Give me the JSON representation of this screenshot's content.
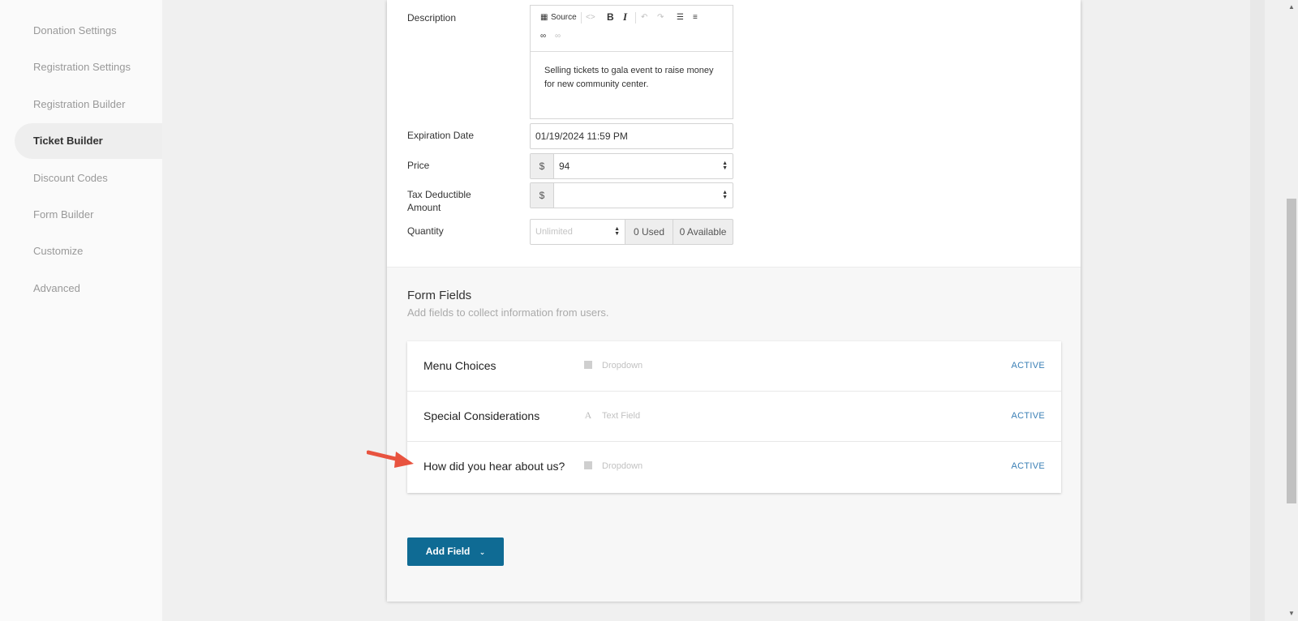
{
  "sidebar": {
    "items": [
      {
        "label": "Donation Settings",
        "active": false
      },
      {
        "label": "Registration Settings",
        "active": false
      },
      {
        "label": "Registration Builder",
        "active": false
      },
      {
        "label": "Ticket Builder",
        "active": true
      },
      {
        "label": "Discount Codes",
        "active": false
      },
      {
        "label": "Form Builder",
        "active": false
      },
      {
        "label": "Customize",
        "active": false
      },
      {
        "label": "Advanced",
        "active": false
      }
    ]
  },
  "ticket": {
    "description_label": "Description",
    "editor": {
      "source_label": "Source",
      "bold_label": "B",
      "italic_label": "I",
      "content": "Selling tickets to gala event to raise money for new community center."
    },
    "expiration_label": "Expiration Date",
    "expiration_value": "01/19/2024 11:59 PM",
    "price_label": "Price",
    "currency_symbol": "$",
    "price_value": "94",
    "tax_label": "Tax Deductible Amount",
    "tax_value": "",
    "quantity_label": "Quantity",
    "quantity_placeholder": "Unlimited",
    "used_label": "0 Used",
    "available_label": "0 Available"
  },
  "form_fields": {
    "title": "Form Fields",
    "subtitle": "Add fields to collect information from users.",
    "fields": [
      {
        "name": "Menu Choices",
        "type": "Dropdown",
        "type_icon": "dropdown-icon",
        "status": "ACTIVE"
      },
      {
        "name": "Special Considerations",
        "type": "Text Field",
        "type_icon": "text-field-icon",
        "status": "ACTIVE"
      },
      {
        "name": "How did you hear about us?",
        "type": "Dropdown",
        "type_icon": "dropdown-icon",
        "status": "ACTIVE"
      }
    ],
    "add_button_label": "Add Field",
    "text_field_glyph": "A"
  },
  "colors": {
    "primary_button": "#0f6b94",
    "status_active": "#3a7fb5",
    "annotation_arrow": "#e8533f"
  }
}
